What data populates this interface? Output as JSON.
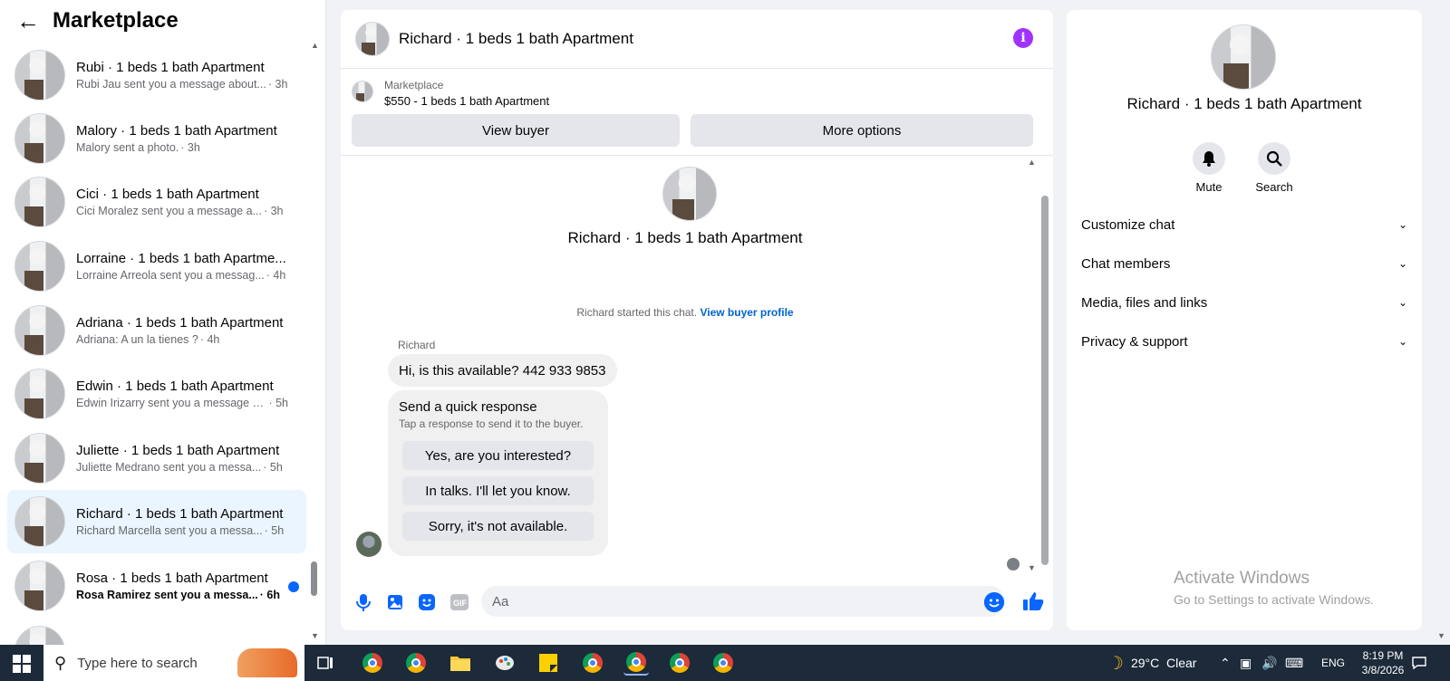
{
  "sidebar": {
    "title": "Marketplace",
    "conversations": [
      {
        "name": "Rubi · 1 beds 1 bath Apartment",
        "message": "Rubi Jau sent you a message about...",
        "time": "· 3h"
      },
      {
        "name": "Malory · 1 beds 1 bath Apartment",
        "message": "Malory sent a photo.",
        "time": "· 3h"
      },
      {
        "name": "Cici · 1 beds 1 bath Apartment",
        "message": "Cici Moralez sent you a message a...",
        "time": "· 3h"
      },
      {
        "name": "Lorraine · 1 beds 1 bath Apartme...",
        "message": "Lorraine Arreola sent you a messag...",
        "time": "· 4h"
      },
      {
        "name": "Adriana · 1 beds 1 bath Apartment",
        "message": "Adriana: A un la tienes ?",
        "time": "· 4h"
      },
      {
        "name": "Edwin · 1 beds 1 bath Apartment",
        "message": "Edwin Irizarry sent you a message a...",
        "time": "· 5h"
      },
      {
        "name": "Juliette · 1 beds 1 bath Apartment",
        "message": "Juliette Medrano sent you a messa...",
        "time": "· 5h"
      },
      {
        "name": "Richard · 1 beds 1 bath Apartment",
        "message": "Richard Marcella sent you a messa...",
        "time": "· 5h"
      },
      {
        "name": "Rosa · 1 beds 1 bath Apartment",
        "message": "Rosa Ramirez sent you a messa...",
        "time": "· 6h"
      }
    ]
  },
  "chat": {
    "title": "Richard · 1 beds 1 bath Apartment",
    "listing_source": "Marketplace",
    "listing_title": "$550 - 1 beds 1 bath Apartment",
    "view_buyer_label": "View buyer",
    "more_options_label": "More options",
    "profile_name": "Richard · 1 beds 1 bath Apartment",
    "started_text": "Richard started this chat.",
    "view_profile_link": "View buyer profile",
    "sender": "Richard",
    "message": "Hi, is this available? 442 933 9853",
    "quick_title": "Send a quick response",
    "quick_subtitle": "Tap a response to send it to the buyer.",
    "quick_responses": [
      "Yes, are you interested?",
      "In talks. I'll let you know.",
      "Sorry, it's not available."
    ],
    "input_placeholder": "Aa"
  },
  "info_panel": {
    "name": "Richard · 1 beds 1 bath Apartment",
    "mute_label": "Mute",
    "search_label": "Search",
    "sections": [
      "Customize chat",
      "Chat members",
      "Media, files and links",
      "Privacy & support"
    ],
    "watermark_title": "Activate Windows",
    "watermark_sub": "Go to Settings to activate Windows."
  },
  "taskbar": {
    "search_placeholder": "Type here to search",
    "weather": "29°C  Clear",
    "language": "ENG",
    "time": "8:19 PM",
    "date": "3/8/2026"
  },
  "colors": {
    "accent": "#0866ff",
    "info_icon": "#a033ff",
    "active_row": "#ebf5ff"
  }
}
